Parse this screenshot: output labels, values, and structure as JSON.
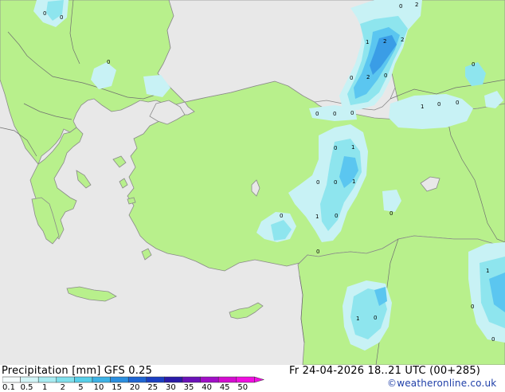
{
  "map": {
    "colors": {
      "land": "#b8f08c",
      "sea": "#e8e8e8",
      "coast": "#8a8a8a",
      "precip_light": "#c8f2f5",
      "precip_mid": "#8ee5ee",
      "precip_heavy": "#5bc6f0",
      "precip_strong": "#3a9de6"
    },
    "point_values": [
      {
        "id": "bg-0",
        "v": "0"
      },
      {
        "id": "bg-0b",
        "v": "0"
      },
      {
        "id": "bg-0c",
        "v": "0"
      },
      {
        "id": "bs-2a",
        "v": "2"
      },
      {
        "id": "bs-0a",
        "v": "0"
      },
      {
        "id": "bs-1",
        "v": "1"
      },
      {
        "id": "bs-2b",
        "v": "2"
      },
      {
        "id": "bs-2c",
        "v": "2"
      },
      {
        "id": "bs-0b",
        "v": "0"
      },
      {
        "id": "bs-2d",
        "v": "2"
      },
      {
        "id": "bs-0c",
        "v": "0"
      },
      {
        "id": "ea-0a",
        "v": "0"
      },
      {
        "id": "ea-1",
        "v": "1"
      },
      {
        "id": "ea-0b",
        "v": "0"
      },
      {
        "id": "ea-0c",
        "v": "0"
      },
      {
        "id": "tr-0a",
        "v": "0"
      },
      {
        "id": "tr-0b",
        "v": "0"
      },
      {
        "id": "tr-0c",
        "v": "0"
      },
      {
        "id": "tr-0d",
        "v": "0"
      },
      {
        "id": "tr-1a",
        "v": "1"
      },
      {
        "id": "tr-0e",
        "v": "0"
      },
      {
        "id": "tr-0f",
        "v": "0"
      },
      {
        "id": "tr-1b",
        "v": "1"
      },
      {
        "id": "tr-0g",
        "v": "0"
      },
      {
        "id": "tr-1c",
        "v": "1"
      },
      {
        "id": "tr-0h",
        "v": "0"
      },
      {
        "id": "tr-0i",
        "v": "0"
      },
      {
        "id": "tr-0j",
        "v": "0"
      },
      {
        "id": "sy-1",
        "v": "1"
      },
      {
        "id": "sy-0",
        "v": "0"
      },
      {
        "id": "se-1",
        "v": "1"
      },
      {
        "id": "se-0a",
        "v": "0"
      },
      {
        "id": "se-0b",
        "v": "0"
      }
    ]
  },
  "footer": {
    "scale_title": "Precipitation [mm]  GFS 0.25",
    "run_info": "Fr 24-04-2026 18..21 UTC (00+285)",
    "credit": "©weatheronline.co.uk"
  },
  "legend": {
    "ticks": [
      "0.1",
      "0.5",
      "1",
      "2",
      "5",
      "10",
      "15",
      "20",
      "25",
      "30",
      "35",
      "40",
      "45",
      "50"
    ],
    "colors": [
      "#f5fcfd",
      "#d2f5f7",
      "#a8ecf2",
      "#7fe0ec",
      "#57cfe9",
      "#3db2e6",
      "#2b8fe0",
      "#1f66d4",
      "#1a3fc2",
      "#2a1aa8",
      "#6a11b8",
      "#a00ec6",
      "#d40cd0",
      "#f00ee0"
    ]
  }
}
